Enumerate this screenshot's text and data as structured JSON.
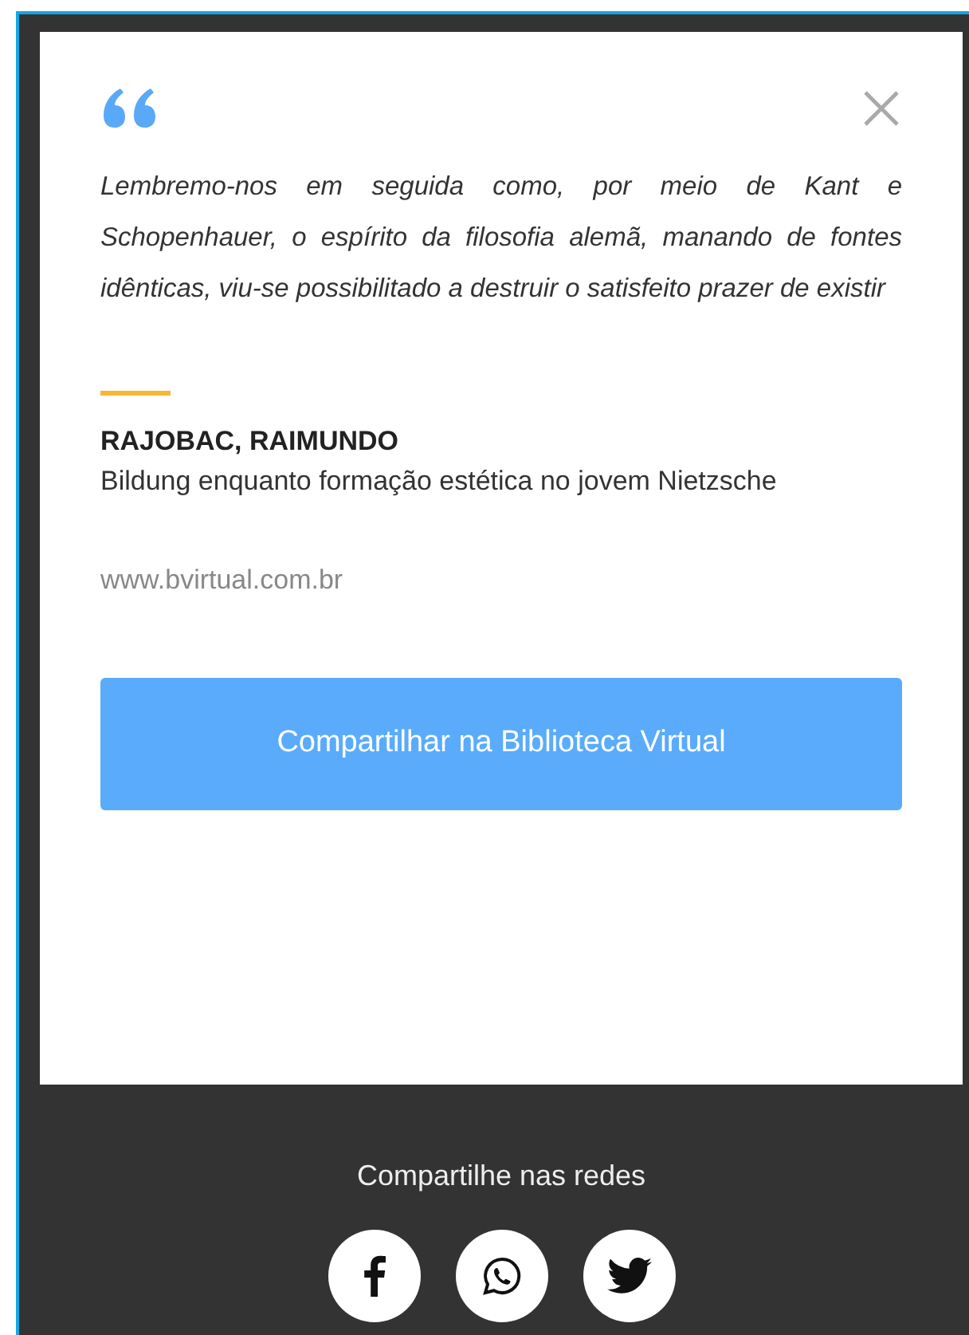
{
  "quote": {
    "text": "Lembremo-nos em seguida como, por meio de Kant e Schopenhauer, o espírito da filosofia alemã, manando de fontes idênticas, viu-se possibilitado a destruir o satisfeito prazer de existir"
  },
  "author": "RAJOBAC, RAIMUNDO",
  "work": "Bildung enquanto formação estética no jovem Nietzsche",
  "source": "www.bvirtual.com.br",
  "share_button": "Compartilhar na Biblioteca Virtual",
  "share_label": "Compartilhe nas redes",
  "social": [
    {
      "kind": "facebook"
    },
    {
      "kind": "whatsapp"
    },
    {
      "kind": "twitter"
    }
  ]
}
